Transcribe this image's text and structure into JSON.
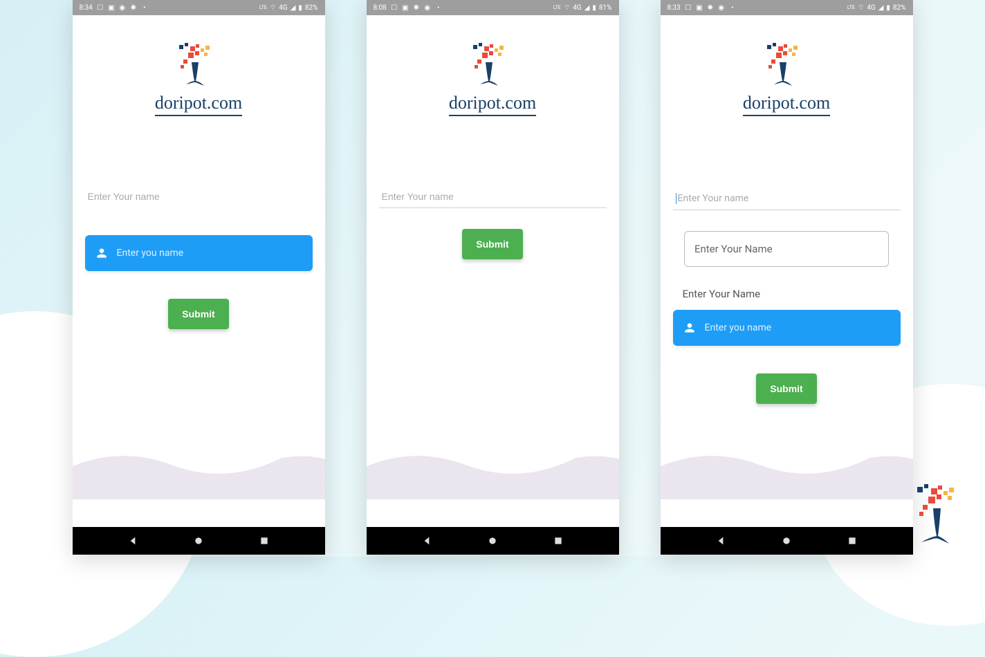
{
  "brand": "doripot.com",
  "screens": [
    {
      "time": "8:34",
      "battery": "82%",
      "network": "4G",
      "fields": {
        "name_placeholder": "Enter Your name",
        "blue_placeholder": "Enter you name"
      },
      "submit_label": "Submit"
    },
    {
      "time": "8:08",
      "battery": "81%",
      "network": "4G",
      "fields": {
        "name_placeholder": "Enter Your name"
      },
      "submit_label": "Submit"
    },
    {
      "time": "8:33",
      "battery": "82%",
      "network": "4G",
      "fields": {
        "name_placeholder": "Enter Your name",
        "outlined_placeholder": "Enter Your Name",
        "label_text": "Enter Your Name",
        "blue_placeholder": "Enter you name"
      },
      "submit_label": "Submit"
    }
  ]
}
